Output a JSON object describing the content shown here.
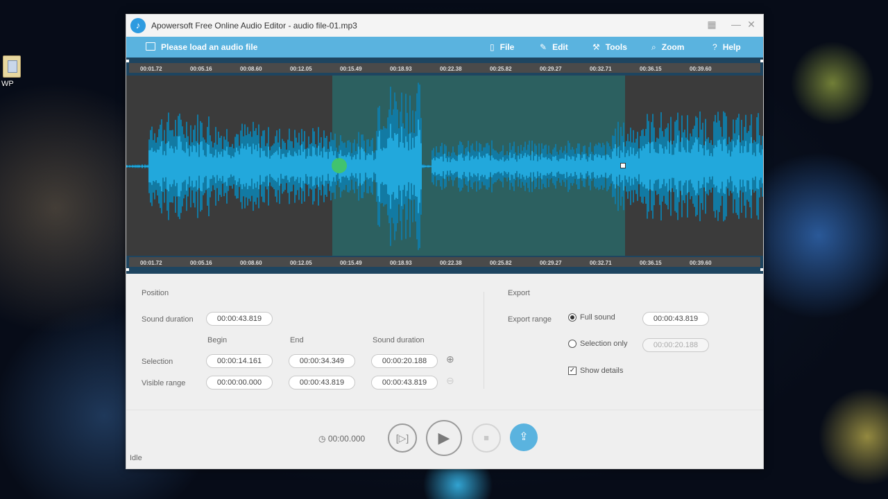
{
  "desktop": {
    "icon_label": "WP"
  },
  "window": {
    "title": "Apowersoft Free Online Audio Editor - audio file-01.mp3",
    "controls": {
      "grid": "▦",
      "minimize": "—",
      "close": "✕"
    }
  },
  "menubar": {
    "load": "Please load an audio file",
    "items": [
      {
        "label": "File",
        "icon": "file-icon"
      },
      {
        "label": "Edit",
        "icon": "pencil-icon"
      },
      {
        "label": "Tools",
        "icon": "wrench-icon"
      },
      {
        "label": "Zoom",
        "icon": "magnifier-icon"
      },
      {
        "label": "Help",
        "icon": "question-icon"
      }
    ]
  },
  "timeline": {
    "ticks": [
      "00:01.72",
      "00:05.16",
      "00:08.60",
      "00:12.05",
      "00:15.49",
      "00:18.93",
      "00:22.38",
      "00:25.82",
      "00:29.27",
      "00:32.71",
      "00:36.15",
      "00:39.60"
    ]
  },
  "position": {
    "heading": "Position",
    "sound_duration_label": "Sound duration",
    "sound_duration": "00:00:43.819",
    "col_begin": "Begin",
    "col_end": "End",
    "col_duration": "Sound duration",
    "selection_label": "Selection",
    "selection_begin": "00:00:14.161",
    "selection_end": "00:00:34.349",
    "selection_duration": "00:00:20.188",
    "visible_label": "Visible range",
    "visible_begin": "00:00:00.000",
    "visible_end": "00:00:43.819",
    "visible_duration": "00:00:43.819"
  },
  "export": {
    "heading": "Export",
    "range_label": "Export range",
    "full_sound_label": "Full sound",
    "full_sound_value": "00:00:43.819",
    "selection_only_label": "Selection only",
    "selection_only_value": "00:00:20.188",
    "show_details_label": "Show details"
  },
  "player": {
    "time": "00:00.000",
    "status": "Idle"
  },
  "colors": {
    "accent": "#5ab3df",
    "wave": "#1aa0d4",
    "selection": "#286e6e"
  }
}
